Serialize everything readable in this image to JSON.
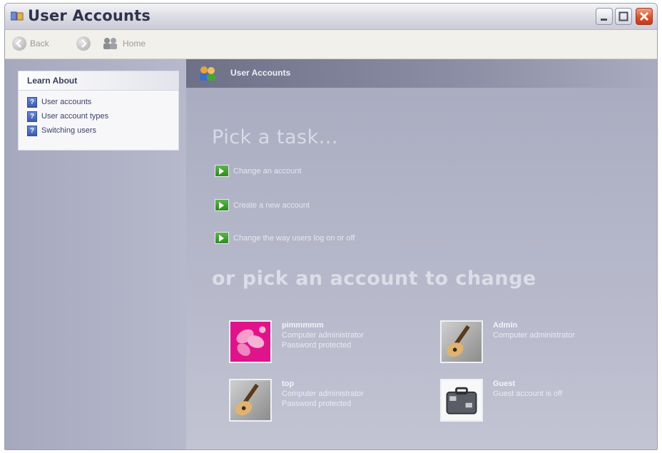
{
  "window": {
    "title": "User Accounts"
  },
  "toolbar": {
    "back_label": "Back",
    "home_label": "Home"
  },
  "learn_about": {
    "heading": "Learn About",
    "items": [
      "User accounts",
      "User account types",
      "Switching users"
    ]
  },
  "main": {
    "header_title": "User Accounts",
    "pick_task": "Pick a task...",
    "tasks": [
      "Change an account",
      "Create a new account",
      "Change the way users log on or off"
    ],
    "pick_account": "or pick an account to change",
    "accounts": [
      {
        "name": "pimmmmm",
        "lines": [
          "Computer administrator",
          "Password protected"
        ],
        "picture": "pink-flower-icon"
      },
      {
        "name": "Admin",
        "lines": [
          "Computer administrator"
        ],
        "picture": "guitar-icon"
      },
      {
        "name": "top",
        "lines": [
          "Computer administrator",
          "Password protected"
        ],
        "picture": "guitar-icon"
      },
      {
        "name": "Guest",
        "lines": [
          "Guest account is off"
        ],
        "picture": "briefcase-icon"
      }
    ]
  },
  "colors": {
    "sidebar_bg": "#b0b2c6",
    "main_bg": "#b1b3c7",
    "header_bg": "#7a7c94",
    "task_arrow": "#3f9b31",
    "close_button": "#d9512c"
  }
}
